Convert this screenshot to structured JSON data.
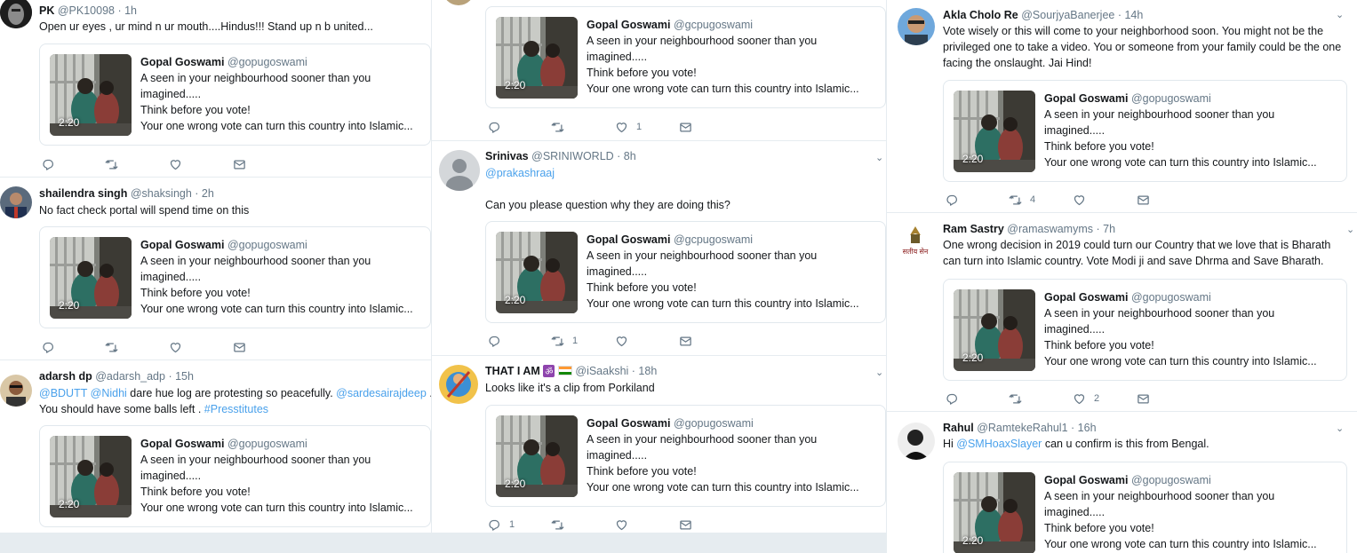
{
  "card": {
    "name": "Gopal Goswami",
    "handle": "@gopugoswami",
    "handle_alt": "@gcpugoswami",
    "line1": "A seen in your neighbourhood sooner than you",
    "line2": "imagined.....",
    "line3": "Think before you vote!",
    "line4": "Your one wrong vote can turn this country into Islamic...",
    "duration": "2:20"
  },
  "col1": [
    {
      "name": "PK",
      "handle": "@PK10098",
      "time": "· 1h",
      "text": "Open ur eyes , ur mind n ur mouth....Hindus!!! Stand up n b united..."
    },
    {
      "name": "shailendra singh",
      "handle": "@shaksingh",
      "time": "· 2h",
      "text": "No fact check portal will spend time on this"
    },
    {
      "name": "adarsh dp",
      "handle": "@adarsh_adp",
      "time": "· 15h",
      "mention1": "@BDUTT",
      "mention2": "@Nidhi",
      "text1": " dare hue log are protesting so peacefully. ",
      "mention3": "@sardesairajdeep",
      "text2": " .",
      "text3": "You should have some balls left . ",
      "hashtag": "#Presstitutes"
    }
  ],
  "col2": [
    {
      "retweets": "",
      "likes": "1"
    },
    {
      "name": "Srinivas",
      "handle": "@SRINIWORLD",
      "time": "· 8h",
      "reply_to": "@prakashraaj",
      "text": "Can you please question why they are doing this?",
      "retweets": "1"
    },
    {
      "name": "THAT I AM",
      "emoji1": "ॐ",
      "handle": "@iSaakshi",
      "time": "· 18h",
      "text": "Looks like it's a clip from Porkiland",
      "replies": "1"
    }
  ],
  "col3": [
    {
      "name": "Akla Cholo Re",
      "handle": "@SourjyaBanerjee",
      "time": "· 14h",
      "line1": "Vote wisely or this will come to your neighborhood soon. You might not be the",
      "line2": "privileged one to take a video. You or someone from your family could be the one",
      "line3": "facing the onslaught. Jai Hind!",
      "retweets": "4"
    },
    {
      "name": "Ram Sastry",
      "handle": "@ramaswamyms",
      "time": "· 7h",
      "line1": "One wrong decision in 2019 could turn our Country that we love that is Bharath",
      "line2": "can turn into Islamic country. Vote Modi ji and save Dhrma and Save Bharath.",
      "likes": "2",
      "avatar_text": "सतीय सेन"
    },
    {
      "name": "Rahul",
      "handle": "@RamtekeRahul1",
      "time": "· 16h",
      "pre": "Hi ",
      "mention": "@SMHoaxSlayer",
      "text": " can u confirm is this from Bengal."
    }
  ],
  "colors": {
    "link": "#4aa1eb",
    "muted": "#657786",
    "border": "#e1e8ed"
  }
}
